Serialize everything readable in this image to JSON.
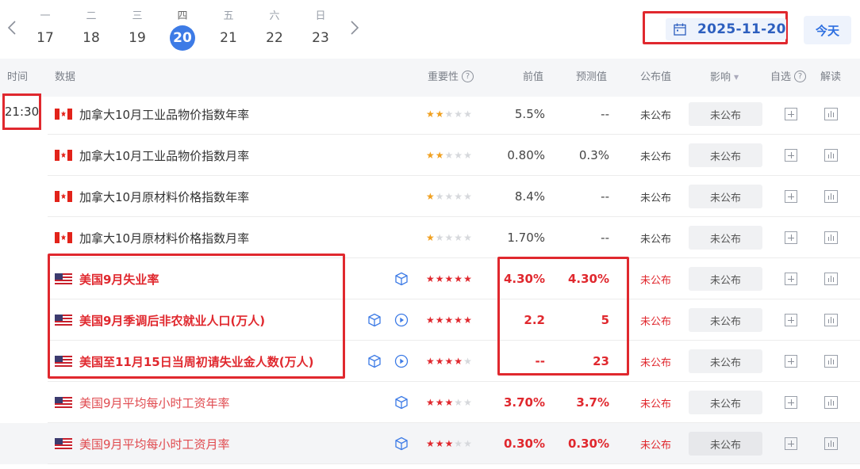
{
  "calendar": {
    "days": [
      {
        "weekday": "一",
        "date": "17"
      },
      {
        "weekday": "二",
        "date": "18"
      },
      {
        "weekday": "三",
        "date": "19"
      },
      {
        "weekday": "四",
        "date": "20"
      },
      {
        "weekday": "五",
        "date": "21"
      },
      {
        "weekday": "六",
        "date": "22"
      },
      {
        "weekday": "日",
        "date": "23"
      }
    ],
    "selected_date": "2025-11-20",
    "today_label": "今天",
    "prev_icon": "chevron-left-icon",
    "next_icon": "chevron-right-icon",
    "date_icon": "calendar-icon"
  },
  "table": {
    "headers": {
      "time": "时间",
      "data": "数据",
      "importance": "重要性",
      "previous": "前值",
      "forecast": "预测值",
      "actual": "公布值",
      "impact": "影响",
      "watchlist": "自选",
      "analysis": "解读"
    },
    "time_group": "21:30",
    "rows": [
      {
        "country": "CA",
        "name": "加拿大10月工业品物价指数年率",
        "stars": 2,
        "previous": "5.5%",
        "forecast": "--",
        "actual": "未公布",
        "impact": "未公布"
      },
      {
        "country": "CA",
        "name": "加拿大10月工业品物价指数月率",
        "stars": 2,
        "previous": "0.80%",
        "forecast": "0.3%",
        "actual": "未公布",
        "impact": "未公布"
      },
      {
        "country": "CA",
        "name": "加拿大10月原材料价格指数年率",
        "stars": 1,
        "previous": "8.4%",
        "forecast": "--",
        "actual": "未公布",
        "impact": "未公布"
      },
      {
        "country": "CA",
        "name": "加拿大10月原材料价格指数月率",
        "stars": 1,
        "previous": "1.70%",
        "forecast": "--",
        "actual": "未公布",
        "impact": "未公布"
      },
      {
        "country": "US",
        "name": "美国9月失业率",
        "stars": 5,
        "previous": "4.30%",
        "forecast": "4.30%",
        "actual": "未公布",
        "impact": "未公布"
      },
      {
        "country": "US",
        "name": "美国9月季调后非农就业人口(万人)",
        "stars": 5,
        "previous": "2.2",
        "forecast": "5",
        "actual": "未公布",
        "impact": "未公布"
      },
      {
        "country": "US",
        "name": "美国至11月15日当周初请失业金人数(万人)",
        "stars": 4,
        "previous": "--",
        "forecast": "23",
        "actual": "未公布",
        "impact": "未公布"
      },
      {
        "country": "US",
        "name": "美国9月平均每小时工资年率",
        "stars": 3,
        "previous": "3.70%",
        "forecast": "3.7%",
        "actual": "未公布",
        "impact": "未公布"
      },
      {
        "country": "US",
        "name": "美国9月平均每小时工资月率",
        "stars": 3,
        "previous": "0.30%",
        "forecast": "0.30%",
        "actual": "未公布",
        "impact": "未公布"
      }
    ]
  },
  "colors": {
    "accent_blue": "#3d7be6",
    "highlight_red": "#e0282e",
    "star_yellow": "#f0a020"
  }
}
